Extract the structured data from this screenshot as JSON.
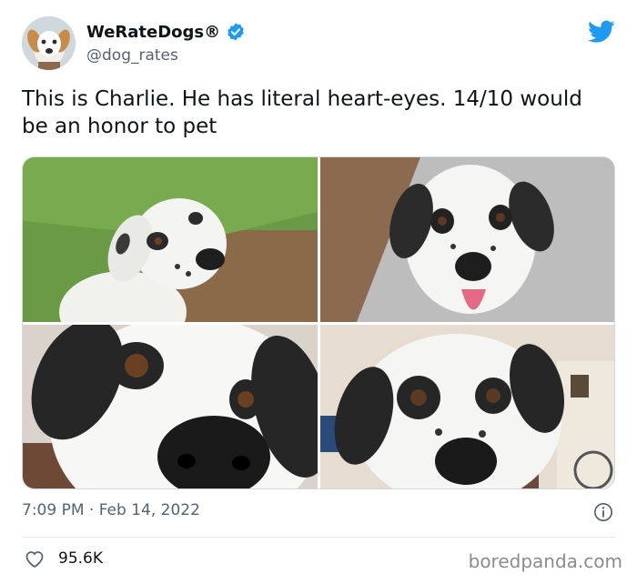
{
  "tweet": {
    "author_name": "WeRateDogs®",
    "handle": "@dog_rates",
    "text": "This is Charlie. He has literal heart-eyes. 14/10 would be an honor to pet",
    "timestamp": "7:09 PM · Feb 14, 2022",
    "likes": "95.6K"
  },
  "watermark": "boredpanda.com",
  "icons": {
    "verified": "verified-badge-icon",
    "platform": "twitter-bird-icon",
    "info": "info-icon",
    "like": "heart-icon"
  },
  "colors": {
    "twitter_blue": "#1d9bf0",
    "secondary_text": "#536471"
  }
}
